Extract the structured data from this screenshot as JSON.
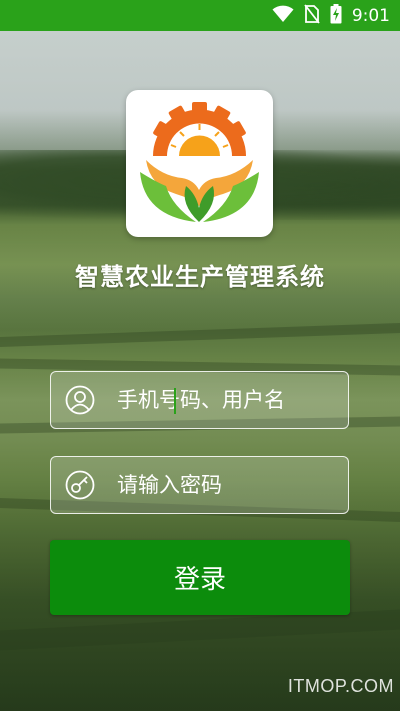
{
  "status_bar": {
    "time": "9:01",
    "background": "#2aa21a",
    "icons": [
      "wifi-icon",
      "no-sim-icon",
      "battery-charging-icon"
    ]
  },
  "app": {
    "logo": "sunrise-gear-leaves-logo",
    "title": "智慧农业生产管理系统"
  },
  "login_form": {
    "username_placeholder": "手机号码、用户名",
    "username_value": "",
    "password_placeholder": "请输入密码",
    "password_value": "",
    "submit_label": "登录",
    "accent": "#0c8c0c"
  },
  "watermark": "ITMOP.COM"
}
